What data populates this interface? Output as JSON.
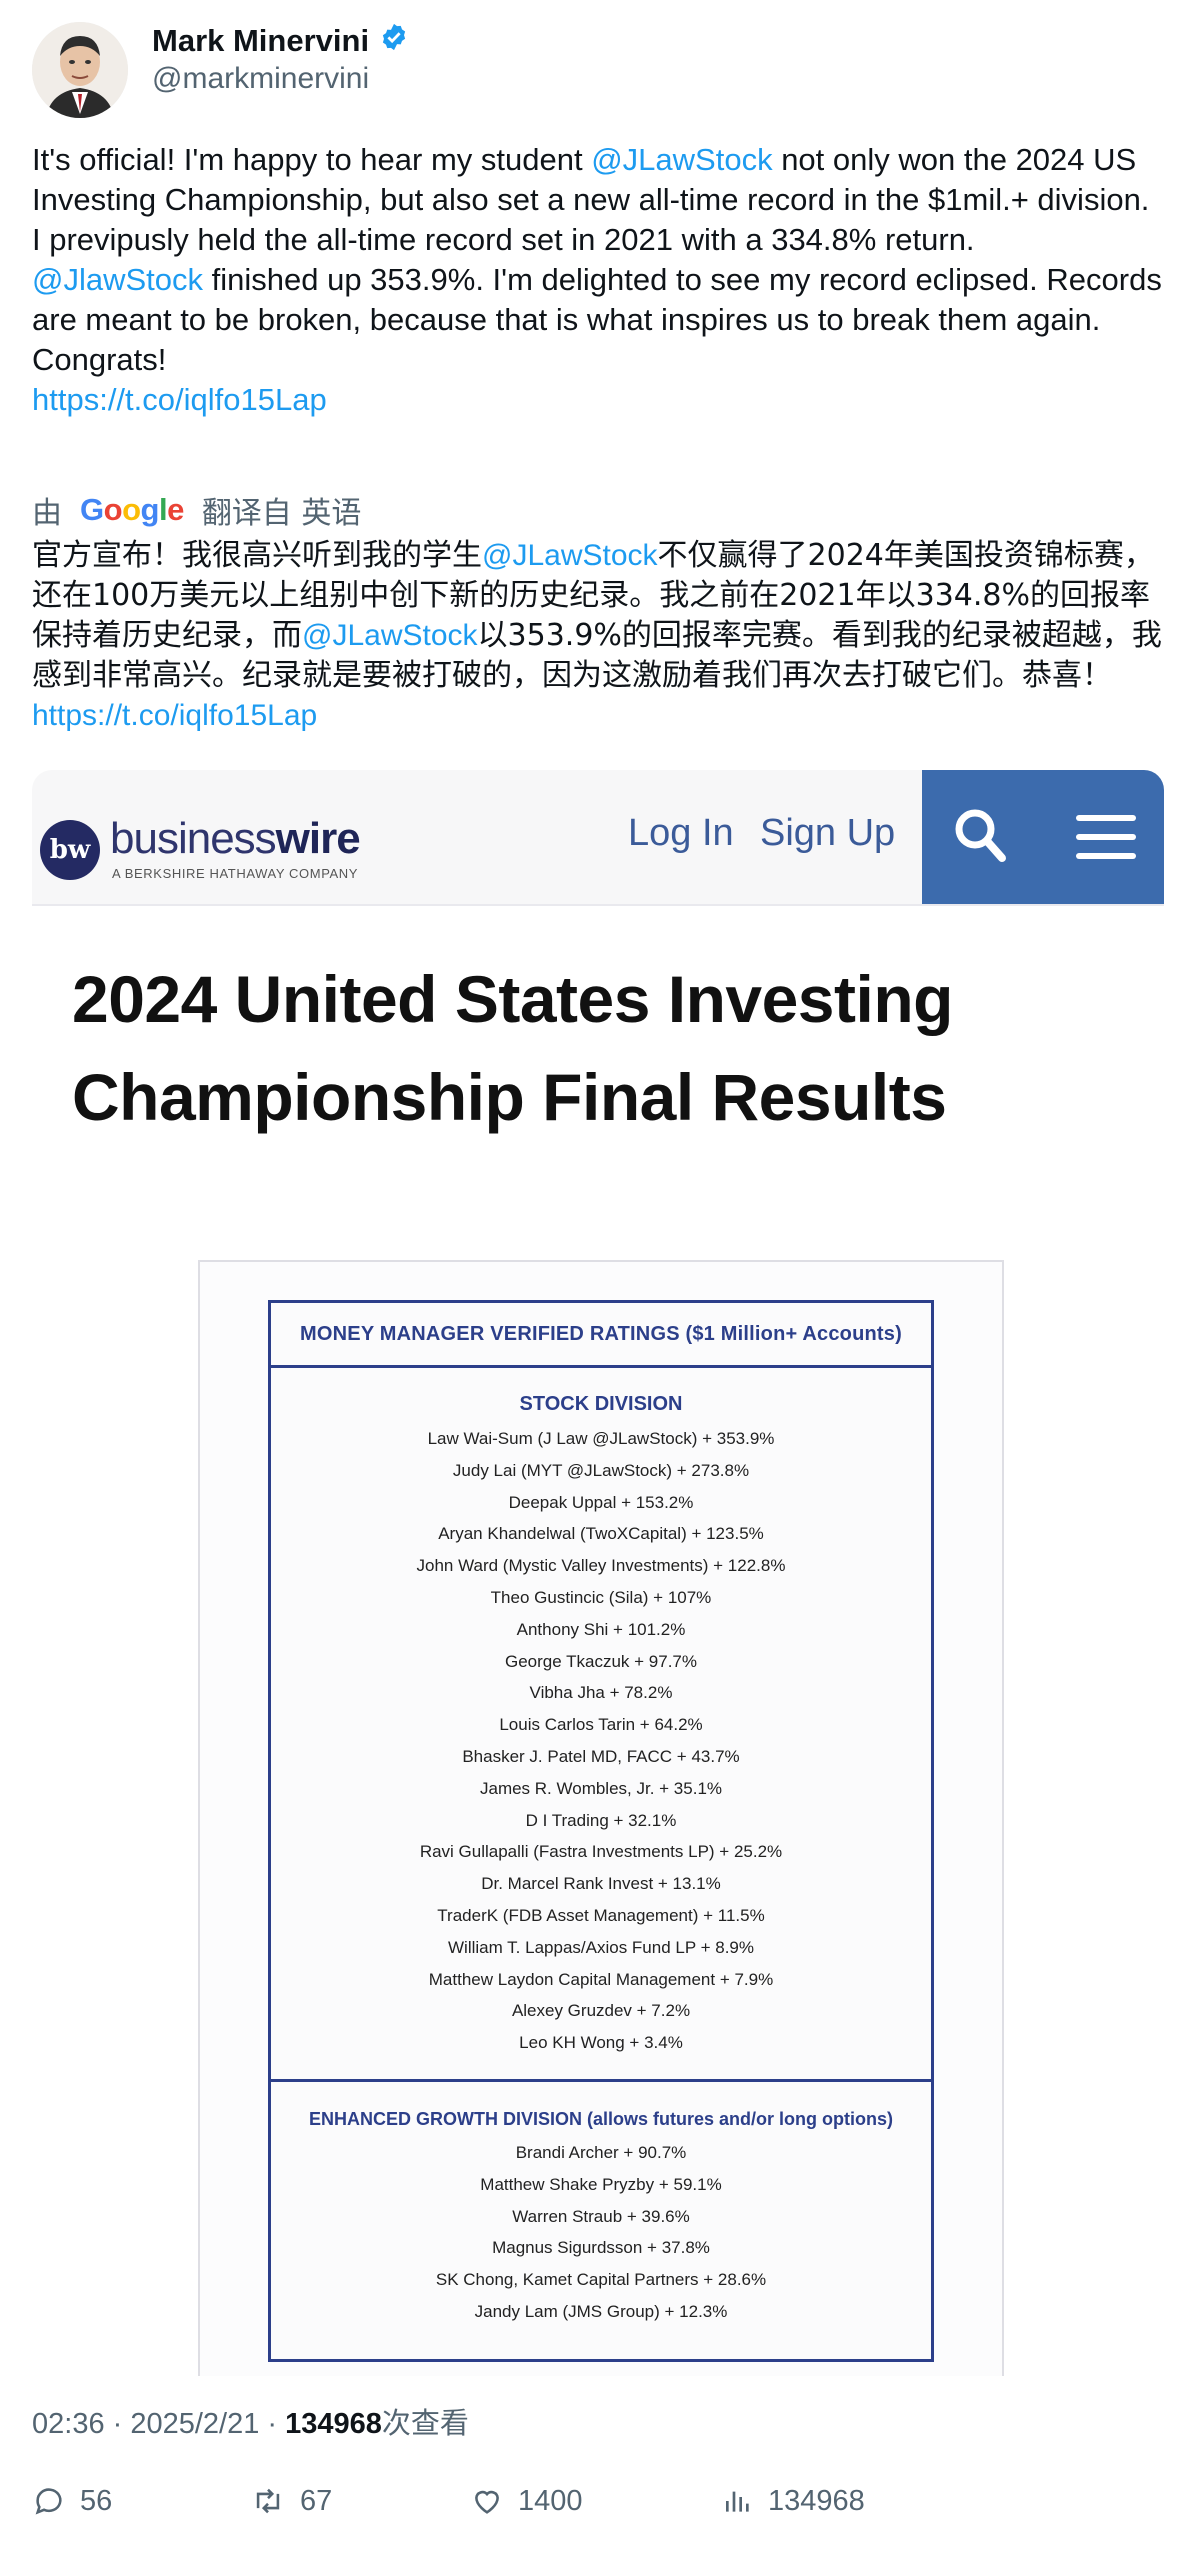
{
  "author": {
    "name": "Mark Minervini",
    "handle": "@markminervini",
    "verified_color": "#1d9bf0"
  },
  "tweet": {
    "line1_pre": "It's official!  I'm happy to hear my student ",
    "line1_mention": "@JLawStock",
    "line1_post": " not only won the 2024 US Investing Championship, but also set a new all-time record in the $1mil.+ division.",
    "line2": "I previpusly held the all-time record set in 2021 with a 334.8% return.",
    "line3_mention": "@JlawStock",
    "line3_post": " finished up 353.9%. I'm delighted to see my  record eclipsed. Records are meant to be broken, because that is what inspires us to break them again. Congrats!",
    "link": "https://t.co/iqlfo15Lap"
  },
  "translation": {
    "by": "由",
    "google": "Google",
    "translated_from": "翻译自 英语",
    "zh_1": "官方宣布！我很高兴听到我的学生",
    "zh_mention_1": "@JLawStock",
    "zh_2": "不仅赢得了2024年美国投资锦标赛，还在100万美元以上组别中创下新的历史纪录。我之前在2021年以334.8%的回报率保持着历史纪录，而",
    "zh_mention_2": "@JLawStock",
    "zh_3": "以353.9%的回报率完赛。看到我的纪录被超越，我感到非常高兴。纪录就是要被打破的，因为这激励着我们再次去打破它们。恭喜！ ",
    "zh_link": "https://t.co/iqlfo15Lap"
  },
  "media": {
    "logo_mark": "bw",
    "logo_text_light": "business",
    "logo_text_bold": "wire",
    "logo_sub": "A BERKSHIRE HATHAWAY COMPANY",
    "login": "Log In",
    "signup": "Sign Up",
    "title_line1": "2024 United States Investing",
    "title_line2": "Championship Final Results",
    "doc_header": "MONEY MANAGER VERIFIED RATINGS ($1 Million+ Accounts)",
    "stock_division": "STOCK DIVISION",
    "stock_results": [
      "Law Wai-Sum (J Law @JLawStock) + 353.9%",
      "Judy Lai (MYT @JLawStock) + 273.8%",
      "Deepak Uppal + 153.2%",
      "Aryan Khandelwal (TwoXCapital) + 123.5%",
      "John Ward (Mystic Valley Investments) + 122.8%",
      "Theo Gustincic (Sila) + 107%",
      "Anthony Shi + 101.2%",
      "George Tkaczuk + 97.7%",
      "Vibha Jha + 78.2%",
      "Louis Carlos Tarin + 64.2%",
      "Bhasker J. Patel MD, FACC + 43.7%",
      "James R. Wombles, Jr. + 35.1%",
      "D I Trading + 32.1%",
      "Ravi Gullapalli (Fastra Investments LP) + 25.2%",
      "Dr. Marcel Rank Invest + 13.1%",
      "TraderK (FDB Asset Management) + 11.5%",
      "William T. Lappas/Axios Fund LP + 8.9%",
      "Matthew Laydon Capital Management + 7.9%",
      "Alexey Gruzdev + 7.2%",
      "Leo KH Wong + 3.4%"
    ],
    "enhanced_division": "ENHANCED GROWTH DIVISION (allows futures and/or long options)",
    "enhanced_results": [
      "Brandi Archer + 90.7%",
      "Matthew Shake Pryzby + 59.1%",
      "Warren Straub + 39.6%",
      "Magnus Sigurdsson + 37.8%",
      "SK Chong, Kamet Capital Partners + 28.6%",
      "Jandy Lam (JMS Group) + 12.3%"
    ]
  },
  "meta": {
    "time": "02:36 · 2025/2/21 · ",
    "views": "134968",
    "views_suffix": "次查看"
  },
  "actions": {
    "replies": "56",
    "reposts": "67",
    "likes": "1400",
    "views": "134968"
  }
}
